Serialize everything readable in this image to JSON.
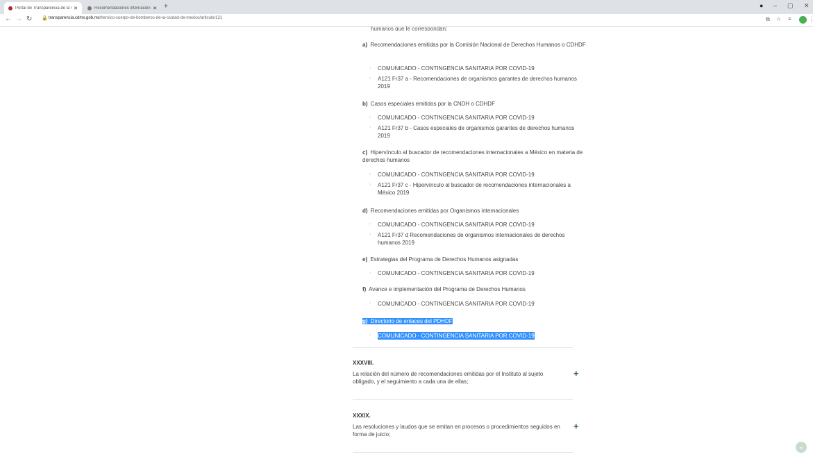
{
  "browser": {
    "tabs": [
      {
        "title": "Portal de Transparencia de la CDMX",
        "active": true
      },
      {
        "title": "Recomendaciones internacionales",
        "active": false
      }
    ],
    "url_domain": "transparencia.cdmx.gob.mx",
    "url_path": "/heroico-cuerpo-de-bomberos-de-la-ciudad-de-mexico/articulo/121"
  },
  "page": {
    "top_cut_text": "humanos que le correspondan;",
    "items": [
      {
        "letter": "a)",
        "text": "Recomendaciones emitidas por la Comisión Nacional de Derechos Humanos o CDHDF",
        "subs": [
          "COMUNICADO - CONTINGENCIA SANITARIA POR COVID-19",
          "A121 Fr37 a - Recomendaciones de organismos garantes de derechos humanos 2019"
        ]
      },
      {
        "letter": "b)",
        "text": "Casos especiales emitidos por la CNDH o CDHDF",
        "subs": [
          "COMUNICADO - CONTINGENCIA SANITARIA POR COVID-19",
          "A121 Fr37 b - Casos especiales de organismos garantes de derechos humanos 2019"
        ]
      },
      {
        "letter": "c)",
        "text": "Hipervínculo al buscador de recomendaciones internacionales a México en materia de derechos humanos",
        "subs": [
          "COMUNICADO - CONTINGENCIA SANITARIA POR COVID-19",
          "A121 Fr37 c - Hipervínculo al buscador de recomendaciones internacionales a México 2019"
        ]
      },
      {
        "letter": "d)",
        "text": "Recomendaciones emitidas por Organismos internacionales",
        "subs": [
          "COMUNICADO - CONTINGENCIA SANITARIA POR COVID-19",
          "A121 Fr37 d Recomendaciones de organismos internacionales de derechos humanos 2019"
        ]
      },
      {
        "letter": "e)",
        "text": "Estrategias del Programa de Derechos Humanos asignadas",
        "subs": [
          "COMUNICADO - CONTINGENCIA SANITARIA POR COVID-19"
        ]
      },
      {
        "letter": "f)",
        "text": "Avance e implementación del Programa de Derechos Humanos",
        "subs": [
          "COMUNICADO - CONTINGENCIA SANITARIA POR COVID-19"
        ]
      },
      {
        "letter": "g)",
        "text": "Directorio de enlaces del PDHDF",
        "subs": [
          "COMUNICADO - CONTINGENCIA SANITARIA POR COVID-19"
        ]
      }
    ],
    "sections": [
      {
        "title": "XXXVIII.",
        "desc": "La relación del número de recomendaciones emitidas por el Instituto al sujeto obligado, y el seguimiento a cada una de ellas;",
        "expand": "+"
      },
      {
        "title": "XXXIX.",
        "desc": "Las resoluciones y laudos que se emitan en procesos o procedimientos seguidos en forma de juicio;",
        "expand": "+"
      }
    ]
  }
}
